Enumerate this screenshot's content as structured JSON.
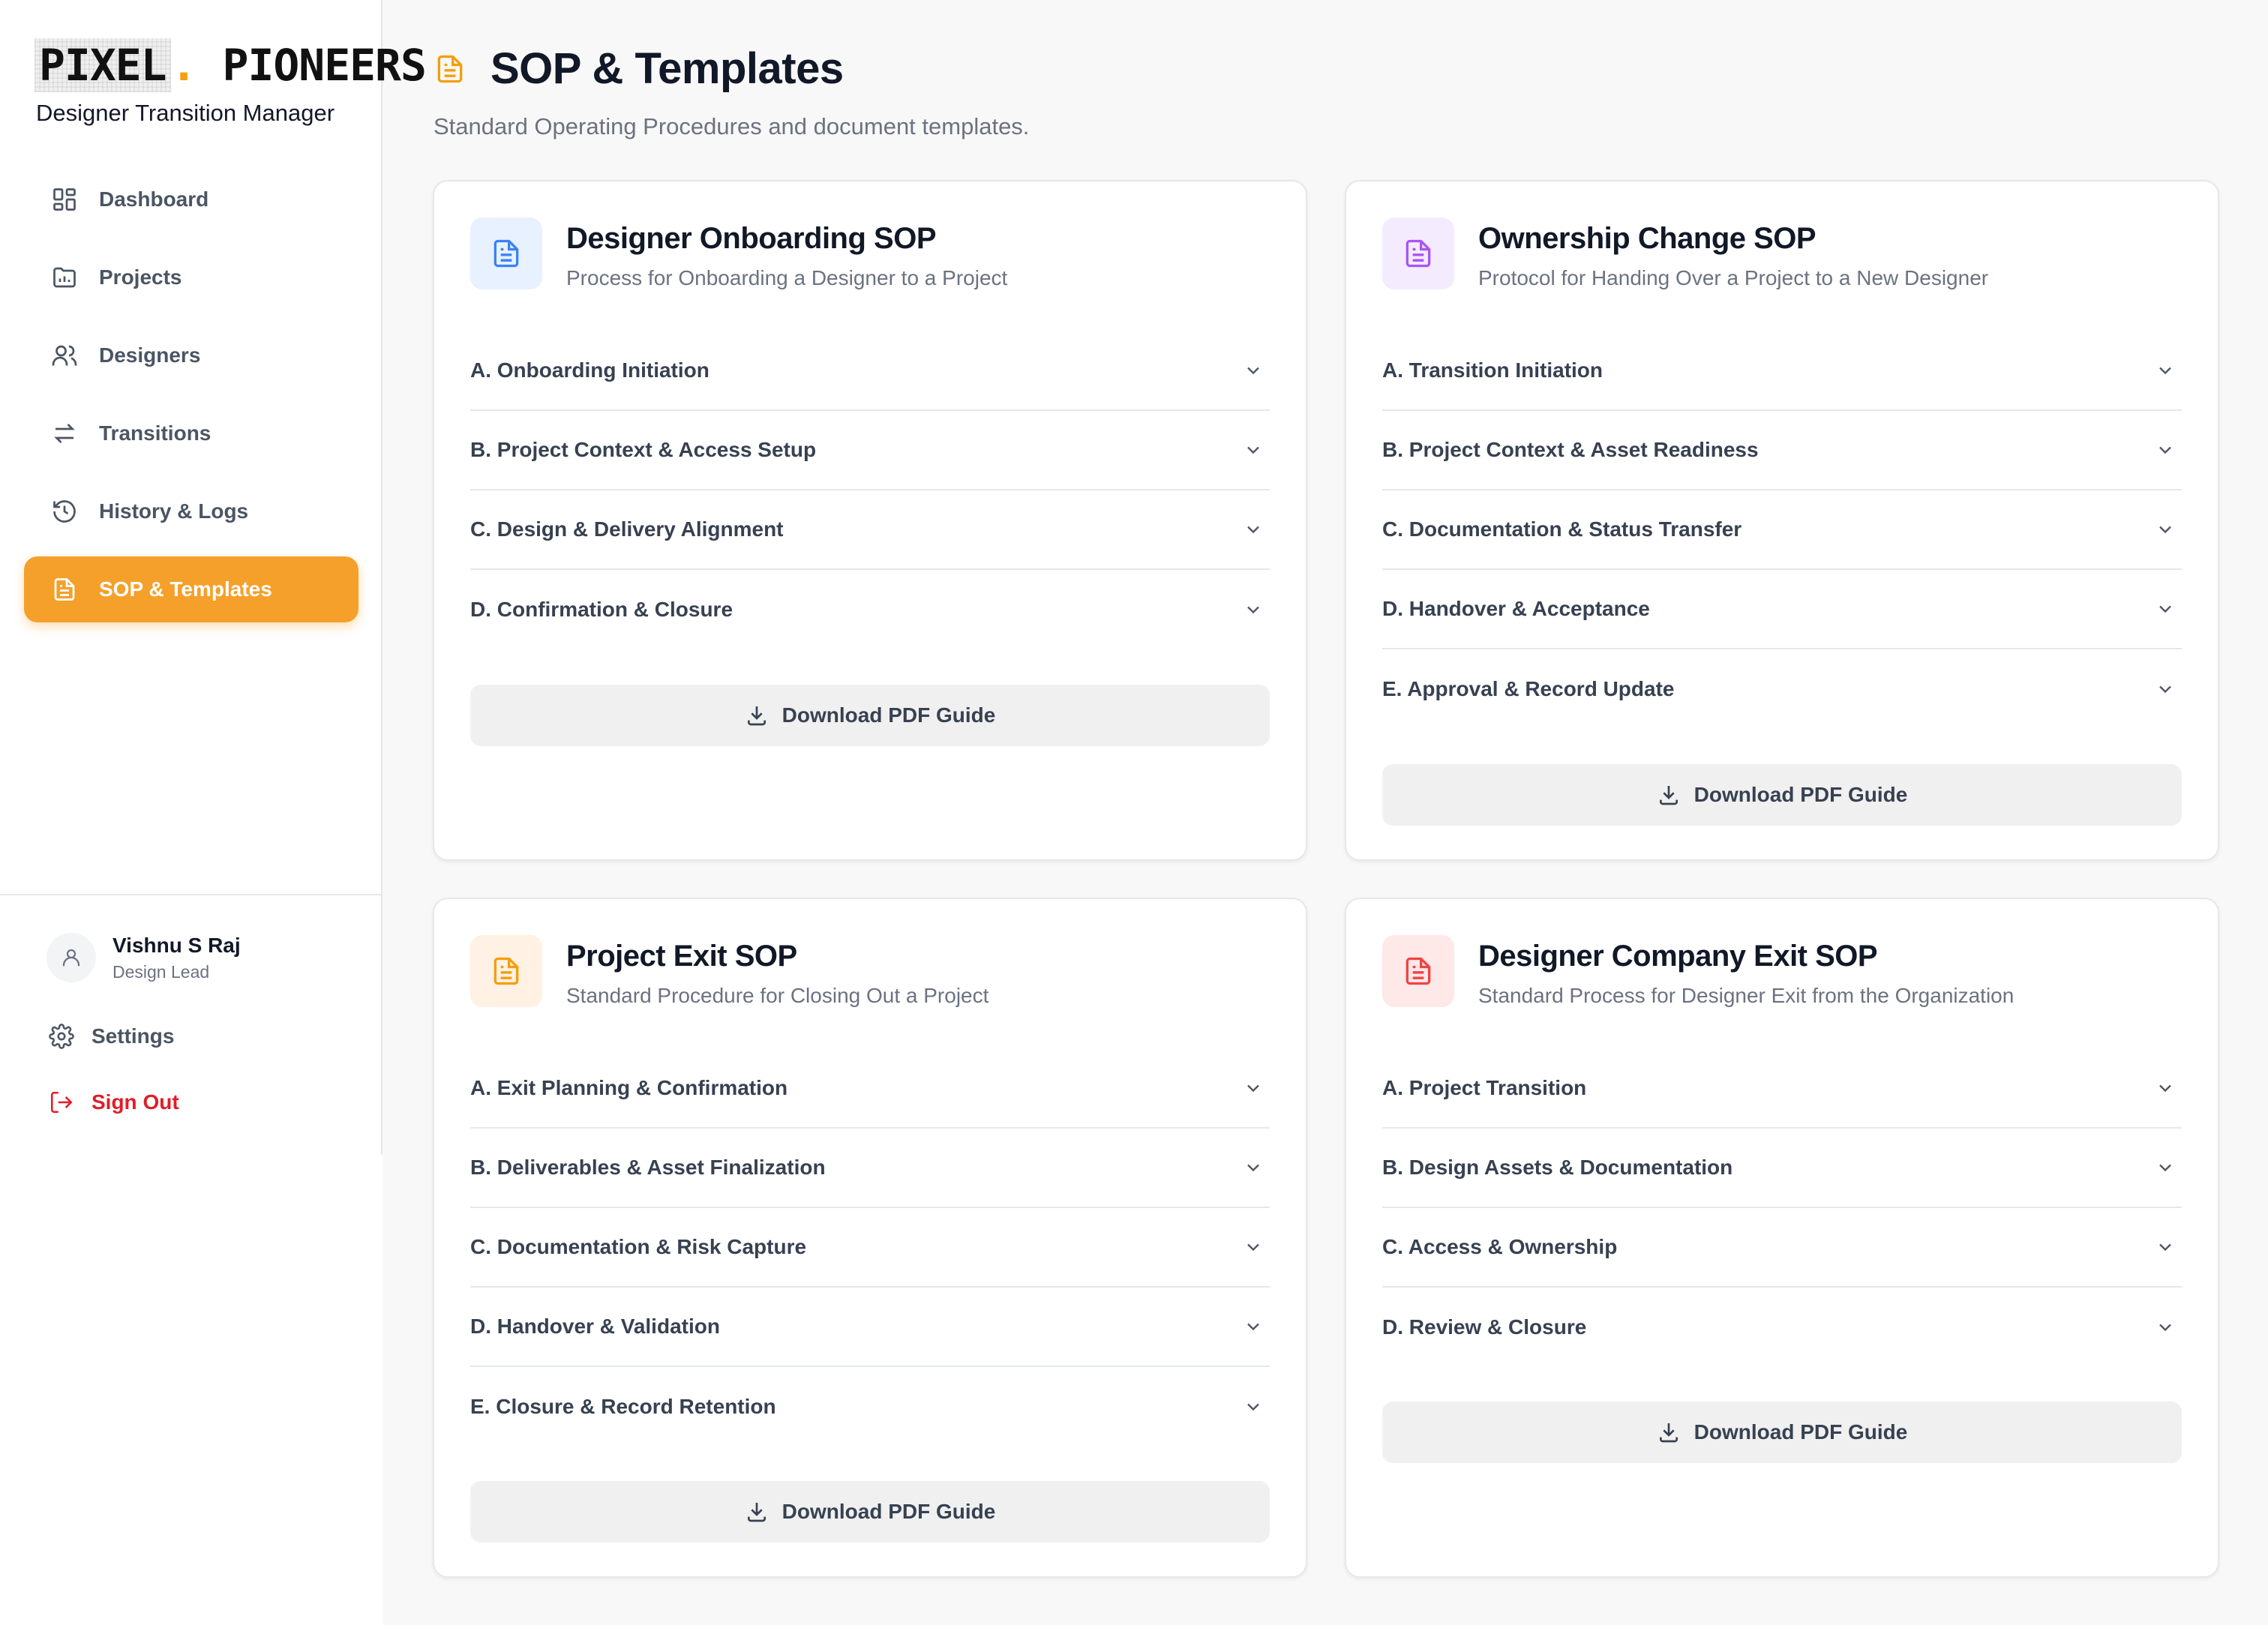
{
  "brand": {
    "logo_left": "PIXEL",
    "logo_dot": ".",
    "logo_right": "PIONEERS",
    "app_subtitle": "Designer Transition Manager",
    "accent_color": "#f5a02a"
  },
  "sidebar": {
    "items": [
      {
        "label": "Dashboard",
        "icon": "dashboard-icon"
      },
      {
        "label": "Projects",
        "icon": "folder-chart-icon"
      },
      {
        "label": "Designers",
        "icon": "users-icon"
      },
      {
        "label": "Transitions",
        "icon": "swap-arrows-icon"
      },
      {
        "label": "History & Logs",
        "icon": "history-icon"
      },
      {
        "label": "SOP & Templates",
        "icon": "document-icon",
        "active": true
      }
    ],
    "user": {
      "name": "Vishnu S Raj",
      "role": "Design Lead"
    },
    "settings_label": "Settings",
    "signout_label": "Sign Out"
  },
  "header": {
    "title": "SOP & Templates",
    "subtitle": "Standard Operating Procedures and document templates."
  },
  "cards": [
    {
      "title": "Designer Onboarding SOP",
      "description": "Process for Onboarding a Designer to a Project",
      "icon_color": "#3b82f6",
      "icon_bg": "#e8f1ff",
      "sections": [
        "A. Onboarding Initiation",
        "B. Project Context & Access Setup",
        "C. Design & Delivery Alignment",
        "D. Confirmation & Closure"
      ],
      "button_label": "Download PDF Guide"
    },
    {
      "title": "Ownership Change SOP",
      "description": "Protocol for Handing Over a Project to a New Designer",
      "icon_color": "#a855f7",
      "icon_bg": "#f5ebff",
      "sections": [
        "A. Transition Initiation",
        "B. Project Context & Asset Readiness",
        "C. Documentation & Status Transfer",
        "D. Handover & Acceptance",
        "E. Approval & Record Update"
      ],
      "button_label": "Download PDF Guide"
    },
    {
      "title": "Project Exit SOP",
      "description": "Standard Procedure for Closing Out a Project",
      "icon_color": "#f59e0b",
      "icon_bg": "#fff1e3",
      "sections": [
        "A. Exit Planning & Confirmation",
        "B. Deliverables & Asset Finalization",
        "C. Documentation & Risk Capture",
        "D. Handover & Validation",
        "E. Closure & Record Retention"
      ],
      "button_label": "Download PDF Guide"
    },
    {
      "title": "Designer Company Exit SOP",
      "description": "Standard Process for Designer Exit from the Organization",
      "icon_color": "#ef4444",
      "icon_bg": "#ffe8e8",
      "sections": [
        "A. Project Transition",
        "B. Design Assets & Documentation",
        "C. Access & Ownership",
        "D. Review & Closure"
      ],
      "button_label": "Download PDF Guide"
    }
  ]
}
